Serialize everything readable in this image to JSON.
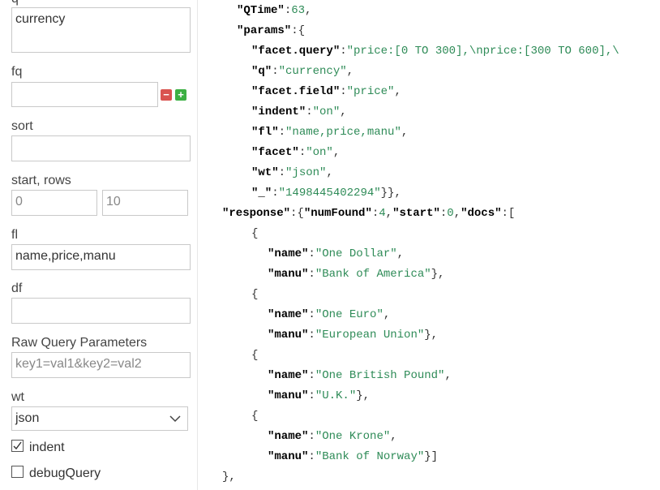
{
  "form": {
    "q_label": "q",
    "q_value": "currency",
    "fq_label": "fq",
    "fq_value": "",
    "sort_label": "sort",
    "sort_value": "",
    "start_rows_label": "start, rows",
    "start_value": "0",
    "rows_value": "10",
    "fl_label": "fl",
    "fl_value": "name,price,manu",
    "df_label": "df",
    "df_value": "",
    "raw_label": "Raw Query Parameters",
    "raw_placeholder": "key1=val1&key2=val2",
    "wt_label": "wt",
    "wt_value": "json",
    "indent_label": "indent",
    "indent_checked": true,
    "debug_label": "debugQuery",
    "debug_checked": false,
    "colors": {
      "remove_button": "#d9534f",
      "add_button": "#3cb043"
    }
  },
  "response_json": {
    "qtime_key": "\"QTime\"",
    "qtime_val": "63",
    "params_key": "\"params\"",
    "facet_query_key": "\"facet.query\"",
    "facet_query_val": "\"price:[0 TO 300],\\nprice:[300 TO 600],\\",
    "q_key": "\"q\"",
    "q_val": "\"currency\"",
    "facet_field_key": "\"facet.field\"",
    "facet_field_val": "\"price\"",
    "indent_key": "\"indent\"",
    "indent_val": "\"on\"",
    "fl_key": "\"fl\"",
    "fl_val": "\"name,price,manu\"",
    "facet_key": "\"facet\"",
    "facet_val": "\"on\"",
    "wt_key": "\"wt\"",
    "wt_val": "\"json\"",
    "underscore_key": "\"_\"",
    "underscore_val": "\"1498445402294\"",
    "response_key": "\"response\"",
    "numfound_key": "\"numFound\"",
    "numfound_val": "4",
    "start_key": "\"start\"",
    "start_val": "0",
    "docs_key": "\"docs\"",
    "name_key": "\"name\"",
    "manu_key": "\"manu\"",
    "docs": [
      {
        "name": "\"One Dollar\"",
        "manu": "\"Bank of America\""
      },
      {
        "name": "\"One Euro\"",
        "manu": "\"European Union\""
      },
      {
        "name": "\"One British Pound\"",
        "manu": "\"U.K.\""
      },
      {
        "name": "\"One Krone\"",
        "manu": "\"Bank of Norway\""
      }
    ]
  }
}
